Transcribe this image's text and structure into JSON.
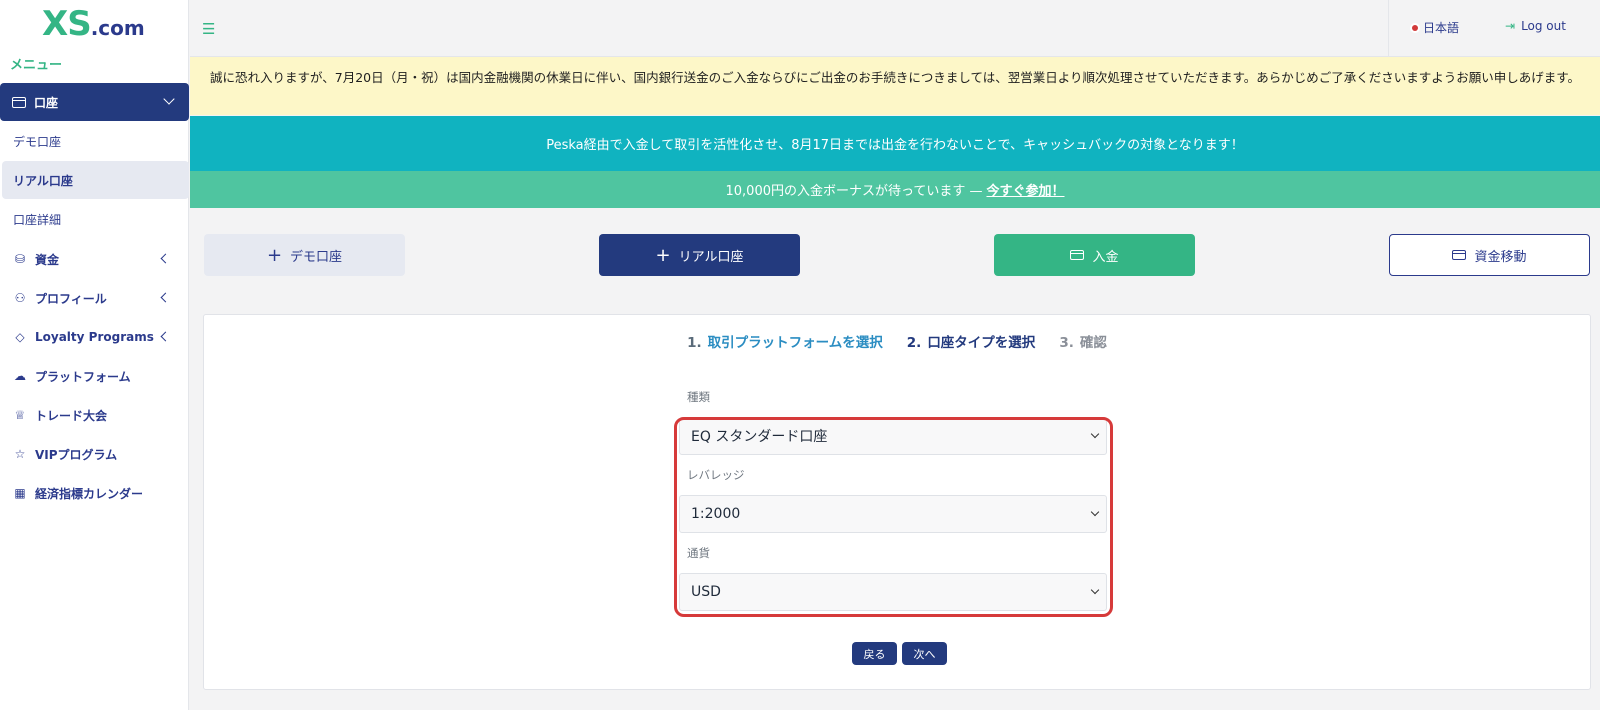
{
  "brand": {
    "logo_main": "XS",
    "logo_suffix": ".com",
    "accent": "#34b585",
    "primary": "#233a7e"
  },
  "sidebar": {
    "menu_label": "メニュー",
    "active": {
      "label": "口座",
      "icon": "wallet-icon"
    },
    "sub_items": [
      "デモ口座",
      "リアル口座",
      "口座詳細"
    ],
    "items": [
      {
        "label": "資金",
        "icon": "coins-icon"
      },
      {
        "label": "プロフィール",
        "icon": "user-icon"
      },
      {
        "label": "Loyalty Programs",
        "icon": "diamond-icon"
      },
      {
        "label": "プラットフォーム",
        "icon": "cloud-download-icon"
      },
      {
        "label": "トレード大会",
        "icon": "trophy-icon"
      },
      {
        "label": "VIPプログラム",
        "icon": "star-icon"
      },
      {
        "label": "経済指標カレンダー",
        "icon": "calendar-icon"
      }
    ]
  },
  "header": {
    "language": "日本語",
    "logout": "Log out"
  },
  "notice": {
    "text": "誠に恐れ入りますが、7月20日（月・祝）は国内金融機関の休業日に伴い、国内銀行送金のご入金ならびにご出金のお手続きにつきましては、翌営業日より順次処理させていただきます。あらかじめご了承くださいますようお願い申しあげます。"
  },
  "banners": {
    "teal": "Peska経由で入金して取引を活性化させ、8月17日までは出金を行わないことで、キャッシュバックの対象となります！",
    "green_text": "10,000円の入金ボーナスが待っています —",
    "green_link": "今すぐ参加！"
  },
  "actions": {
    "demo": "デモ口座",
    "real": "リアル口座",
    "deposit": "入金",
    "transfer": "資金移動"
  },
  "steps": [
    {
      "num": "1.",
      "label": "取引プラットフォームを選択"
    },
    {
      "num": "2.",
      "label": "口座タイプを選択"
    },
    {
      "num": "3.",
      "label": "確認"
    }
  ],
  "form": {
    "type_label": "種類",
    "type_value": "EQ スタンダード口座",
    "leverage_label": "レバレッジ",
    "leverage_value": "1:2000",
    "currency_label": "通貨",
    "currency_value": "USD"
  },
  "buttons": {
    "back": "戻る",
    "next": "次へ"
  }
}
